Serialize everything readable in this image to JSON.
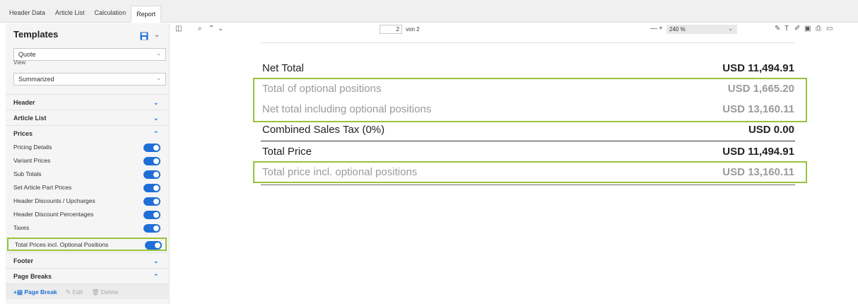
{
  "tabs": [
    {
      "label": "Header Data",
      "active": false
    },
    {
      "label": "Article List",
      "active": false
    },
    {
      "label": "Calculation",
      "active": false
    },
    {
      "label": "Report",
      "active": true
    }
  ],
  "sidebar": {
    "title": "Templates",
    "template_select": "Quote",
    "view_label": "View",
    "view_select": "Summarized",
    "sections": {
      "header": "Header",
      "article_list": "Article List",
      "prices": "Prices",
      "footer": "Footer",
      "page_breaks": "Page Breaks"
    },
    "price_options": [
      {
        "label": "Pricing Details",
        "on": true
      },
      {
        "label": "Variant Prices",
        "on": true
      },
      {
        "label": "Sub Totals",
        "on": true
      },
      {
        "label": "Set Article Part Prices",
        "on": true
      },
      {
        "label": "Header Discounts / Upcharges",
        "on": true
      },
      {
        "label": "Header Discount Percentages",
        "on": true
      },
      {
        "label": "Taxes",
        "on": true
      },
      {
        "label": "Total Prices incl. Optional Positions",
        "on": true
      }
    ],
    "page_break_actions": {
      "add": "Page Break",
      "edit": "Edit",
      "delete": "Delete"
    }
  },
  "viewer": {
    "page_current": "2",
    "page_of": "von 2",
    "zoom": "240 %"
  },
  "report": {
    "rows": [
      {
        "label": "Net Total",
        "value": "USD 11,494.91"
      },
      {
        "label": "Total of optional positions",
        "value": "USD 1,665.20"
      },
      {
        "label": "Net total including optional positions",
        "value": "USD 13,160.11"
      },
      {
        "label": "Combined Sales Tax (0%)",
        "value": "USD 0.00"
      },
      {
        "label": "Total Price",
        "value": "USD 11,494.91"
      },
      {
        "label": "Total price incl. optional positions",
        "value": "USD 13,160.11"
      }
    ]
  },
  "colors": {
    "accent": "#1f6fd6",
    "highlight": "#9ac23c"
  }
}
